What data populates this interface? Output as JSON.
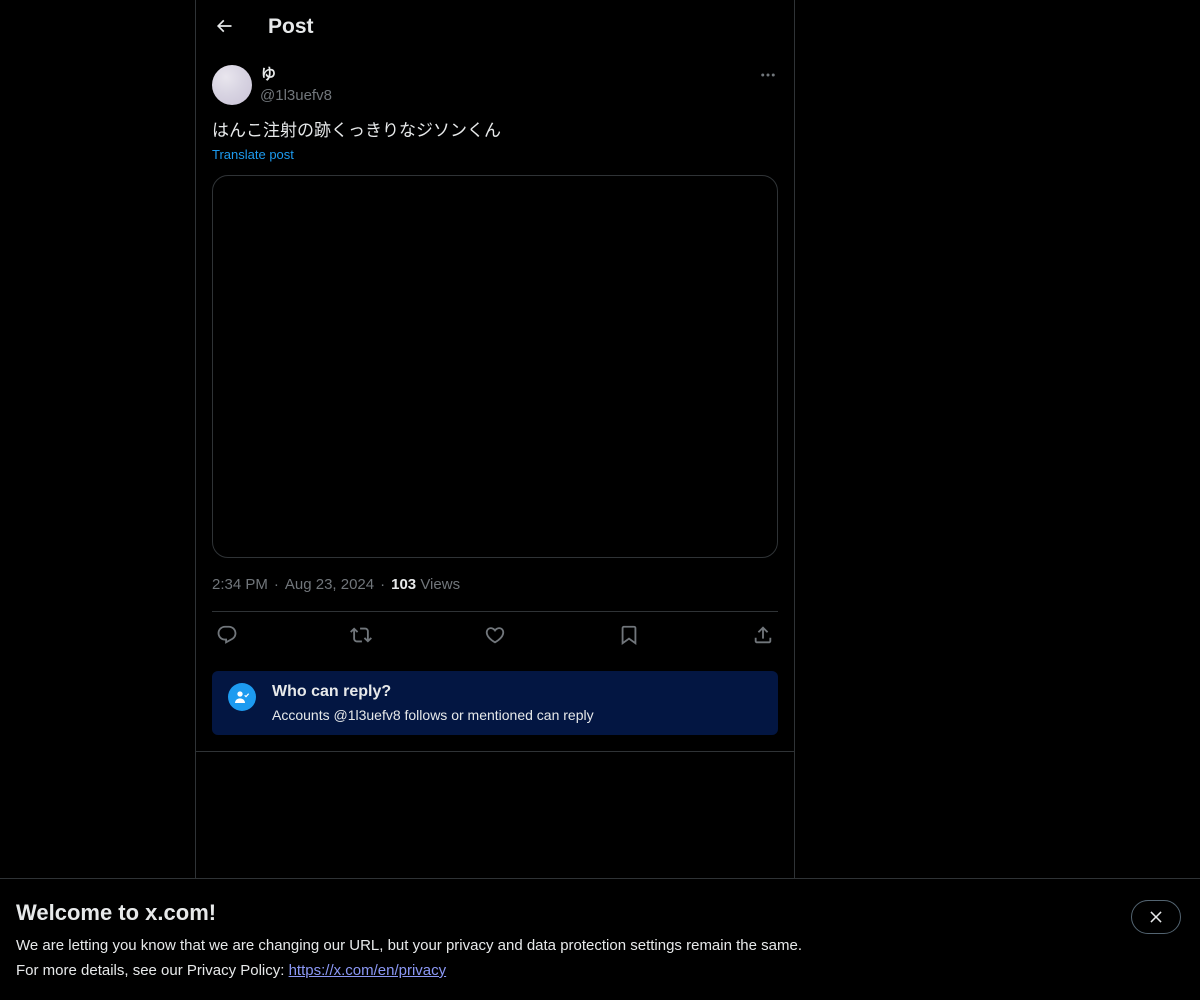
{
  "header": {
    "title": "Post",
    "back_icon": "arrow-left-icon"
  },
  "post": {
    "author": {
      "name": "ゆ",
      "handle": "@1l3uefv8"
    },
    "text": "はんこ注射の跡くっきりなジソンくん",
    "translate_label": "Translate post",
    "time": "2:34 PM",
    "date": "Aug 23, 2024",
    "views_count": "103",
    "views_label": "Views",
    "separator": "·",
    "actions": [
      "reply-icon",
      "repost-icon",
      "like-icon",
      "bookmark-icon",
      "share-icon"
    ]
  },
  "reply_restriction": {
    "title": "Who can reply?",
    "subtitle": "Accounts @1l3uefv8 follows or mentioned can reply"
  },
  "banner": {
    "title": "Welcome to x.com!",
    "line1": "We are letting you know that we are changing our URL, but your privacy and data protection settings remain the same.",
    "line2_prefix": "For more details, see our Privacy Policy: ",
    "link_text": "https://x.com/en/privacy"
  },
  "colors": {
    "background": "#000000",
    "text": "#e7e9ea",
    "muted": "#71767b",
    "accent": "#1d9bf0",
    "reply_box": "#031642",
    "link": "#8b98f5"
  }
}
